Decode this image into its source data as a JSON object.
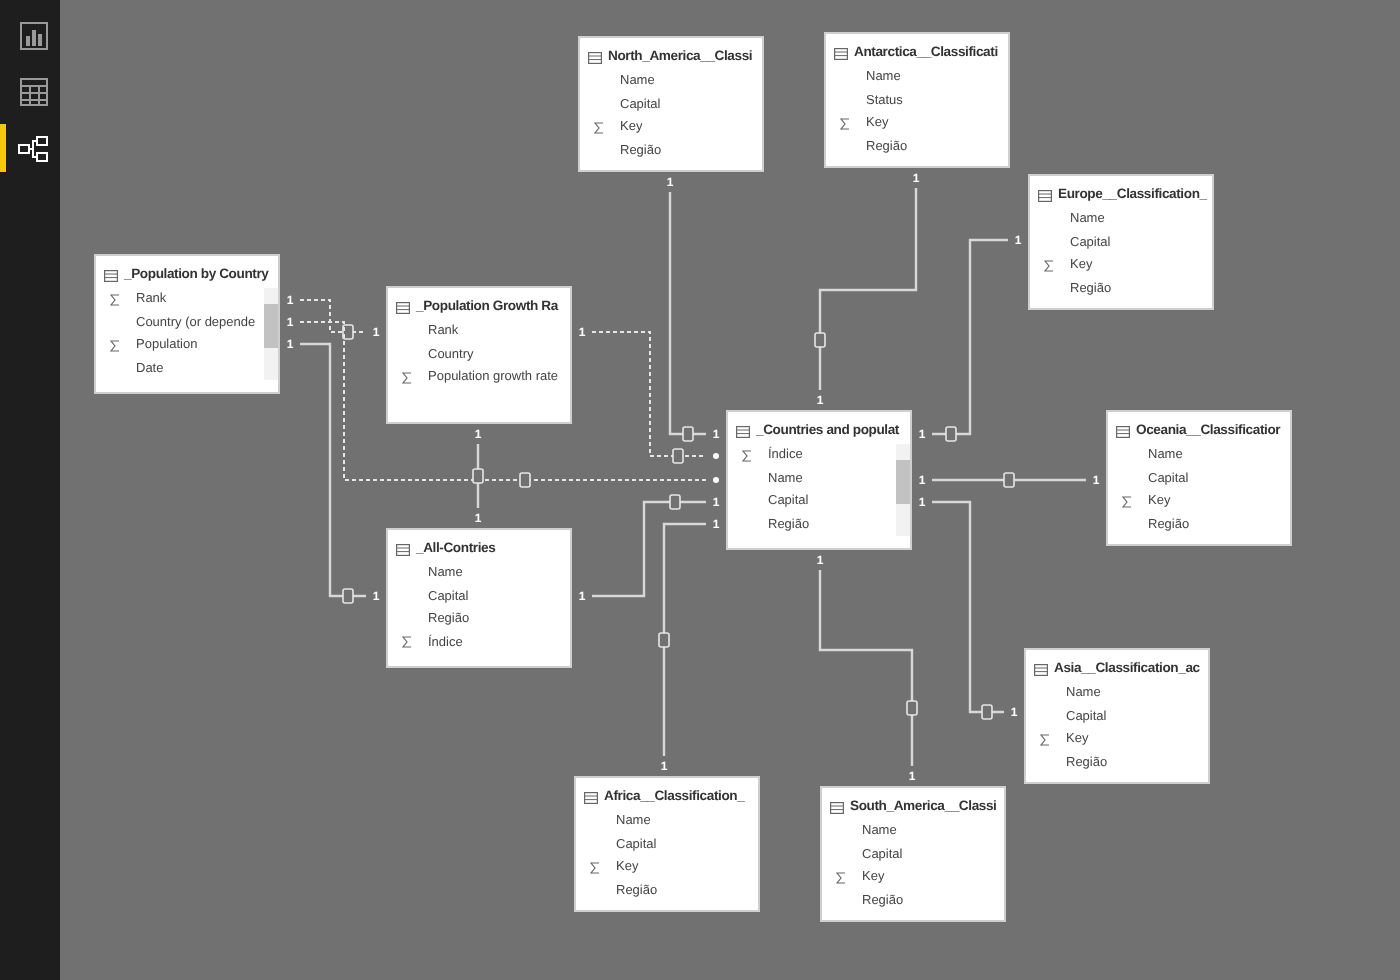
{
  "sidebar": {
    "items": [
      {
        "kind": "report",
        "selected": false
      },
      {
        "kind": "data",
        "selected": false
      },
      {
        "kind": "relationships",
        "selected": true
      }
    ]
  },
  "tables": [
    {
      "name": "_Population by Country",
      "scrollbar": true,
      "fields": [
        {
          "name": "Rank",
          "numeric": true
        },
        {
          "name": "Country (or depende",
          "numeric": false
        },
        {
          "name": "Population",
          "numeric": true
        },
        {
          "name": "Date",
          "numeric": false
        }
      ]
    },
    {
      "name": "_Population Growth Ra",
      "scrollbar": false,
      "fields": [
        {
          "name": "Rank",
          "numeric": false
        },
        {
          "name": "Country",
          "numeric": false
        },
        {
          "name": "Population growth rate",
          "numeric": true
        }
      ]
    },
    {
      "name": "_All-Contries",
      "scrollbar": false,
      "fields": [
        {
          "name": "Name",
          "numeric": false
        },
        {
          "name": "Capital",
          "numeric": false
        },
        {
          "name": "Região",
          "numeric": false
        },
        {
          "name": "Índice",
          "numeric": true
        }
      ]
    },
    {
      "name": "North_America__Classi",
      "scrollbar": false,
      "fields": [
        {
          "name": "Name",
          "numeric": false
        },
        {
          "name": "Capital",
          "numeric": false
        },
        {
          "name": "Key",
          "numeric": true
        },
        {
          "name": "Região",
          "numeric": false
        }
      ]
    },
    {
      "name": "Antarctica__Classificati",
      "scrollbar": false,
      "fields": [
        {
          "name": "Name",
          "numeric": false
        },
        {
          "name": "Status",
          "numeric": false
        },
        {
          "name": "Key",
          "numeric": true
        },
        {
          "name": "Região",
          "numeric": false
        }
      ]
    },
    {
      "name": "Europe__Classification_",
      "scrollbar": false,
      "fields": [
        {
          "name": "Name",
          "numeric": false
        },
        {
          "name": "Capital",
          "numeric": false
        },
        {
          "name": "Key",
          "numeric": true
        },
        {
          "name": "Região",
          "numeric": false
        }
      ]
    },
    {
      "name": "_Countries and populat",
      "scrollbar": true,
      "fields": [
        {
          "name": "Índice",
          "numeric": true
        },
        {
          "name": "Name",
          "numeric": false
        },
        {
          "name": "Capital",
          "numeric": false
        },
        {
          "name": "Região",
          "numeric": false
        }
      ]
    },
    {
      "name": "Oceania__Classificatior",
      "scrollbar": false,
      "fields": [
        {
          "name": "Name",
          "numeric": false
        },
        {
          "name": "Capital",
          "numeric": false
        },
        {
          "name": "Key",
          "numeric": true
        },
        {
          "name": "Região",
          "numeric": false
        }
      ]
    },
    {
      "name": "Asia__Classification_ac",
      "scrollbar": false,
      "fields": [
        {
          "name": "Name",
          "numeric": false
        },
        {
          "name": "Capital",
          "numeric": false
        },
        {
          "name": "Key",
          "numeric": true
        },
        {
          "name": "Região",
          "numeric": false
        }
      ]
    },
    {
      "name": "Africa__Classification_",
      "scrollbar": false,
      "fields": [
        {
          "name": "Name",
          "numeric": false
        },
        {
          "name": "Capital",
          "numeric": false
        },
        {
          "name": "Key",
          "numeric": true
        },
        {
          "name": "Região",
          "numeric": false
        }
      ]
    },
    {
      "name": "South_America__Classi",
      "scrollbar": false,
      "fields": [
        {
          "name": "Name",
          "numeric": false
        },
        {
          "name": "Capital",
          "numeric": false
        },
        {
          "name": "Key",
          "numeric": true
        },
        {
          "name": "Região",
          "numeric": false
        }
      ]
    }
  ],
  "relationships": [
    {
      "active": true,
      "from_label": "1",
      "to_label": "1",
      "to_many": false
    },
    {
      "active": true,
      "from_label": "1",
      "to_label": "1",
      "to_many": false
    },
    {
      "active": true,
      "from_label": "1",
      "to_label": "1",
      "to_many": false
    },
    {
      "active": false,
      "from_label": "1",
      "to_label": "1",
      "to_many": false
    },
    {
      "active": false,
      "from_label": "1",
      "to_many": true
    },
    {
      "active": false,
      "from_label": "1",
      "to_many": true
    },
    {
      "active": true,
      "from_label": "1",
      "to_label": "1",
      "to_many": false
    },
    {
      "active": true,
      "from_label": "1",
      "to_label": "1",
      "to_many": false
    },
    {
      "active": true,
      "from_label": "1",
      "to_label": "1",
      "to_many": false
    },
    {
      "active": true,
      "from_label": "1",
      "to_label": "1",
      "to_many": false
    },
    {
      "active": true,
      "from_label": "1",
      "to_label": "1",
      "to_many": false
    },
    {
      "active": true,
      "from_label": "1",
      "to_label": "1",
      "to_many": false
    },
    {
      "active": true,
      "from_label": "1",
      "to_label": "1",
      "to_many": false
    }
  ]
}
